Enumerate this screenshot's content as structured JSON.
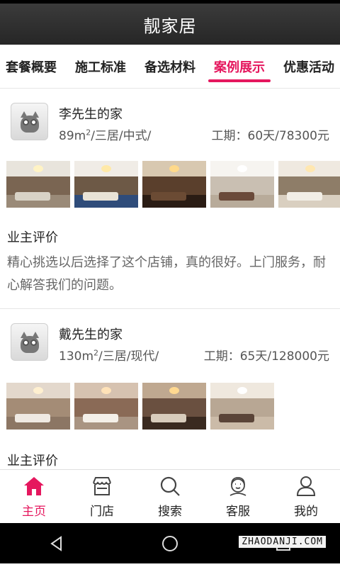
{
  "app": {
    "title": "靓家居"
  },
  "tabs": [
    {
      "label": "套餐概要"
    },
    {
      "label": "施工标准"
    },
    {
      "label": "备选材料"
    },
    {
      "label": "案例展示",
      "active": true
    },
    {
      "label": "优惠活动"
    }
  ],
  "cases": [
    {
      "name": "李先生的家",
      "area": "89m",
      "sup": "2",
      "spec_rest": "/三居/中式/",
      "period": "工期：60天/78300元",
      "review_title": "业主评价",
      "review_text": "精心挑选以后选择了这个店铺，真的很好。上门服务，耐心解答我们的问题。"
    },
    {
      "name": "戴先生的家",
      "area": "130m",
      "sup": "2",
      "spec_rest": "/三居/现代/",
      "period": "工期：65天/128000元",
      "review_title": "业主评价"
    }
  ],
  "nav": [
    {
      "label": "主页",
      "icon": "home-icon",
      "active": true
    },
    {
      "label": "门店",
      "icon": "store-icon"
    },
    {
      "label": "搜索",
      "icon": "search-icon"
    },
    {
      "label": "客服",
      "icon": "customer-service-icon"
    },
    {
      "label": "我的",
      "icon": "user-icon"
    }
  ],
  "watermark": "ZHAODANJI.COM",
  "colors": {
    "accent": "#e5175e",
    "header": "#2f2f2f"
  }
}
